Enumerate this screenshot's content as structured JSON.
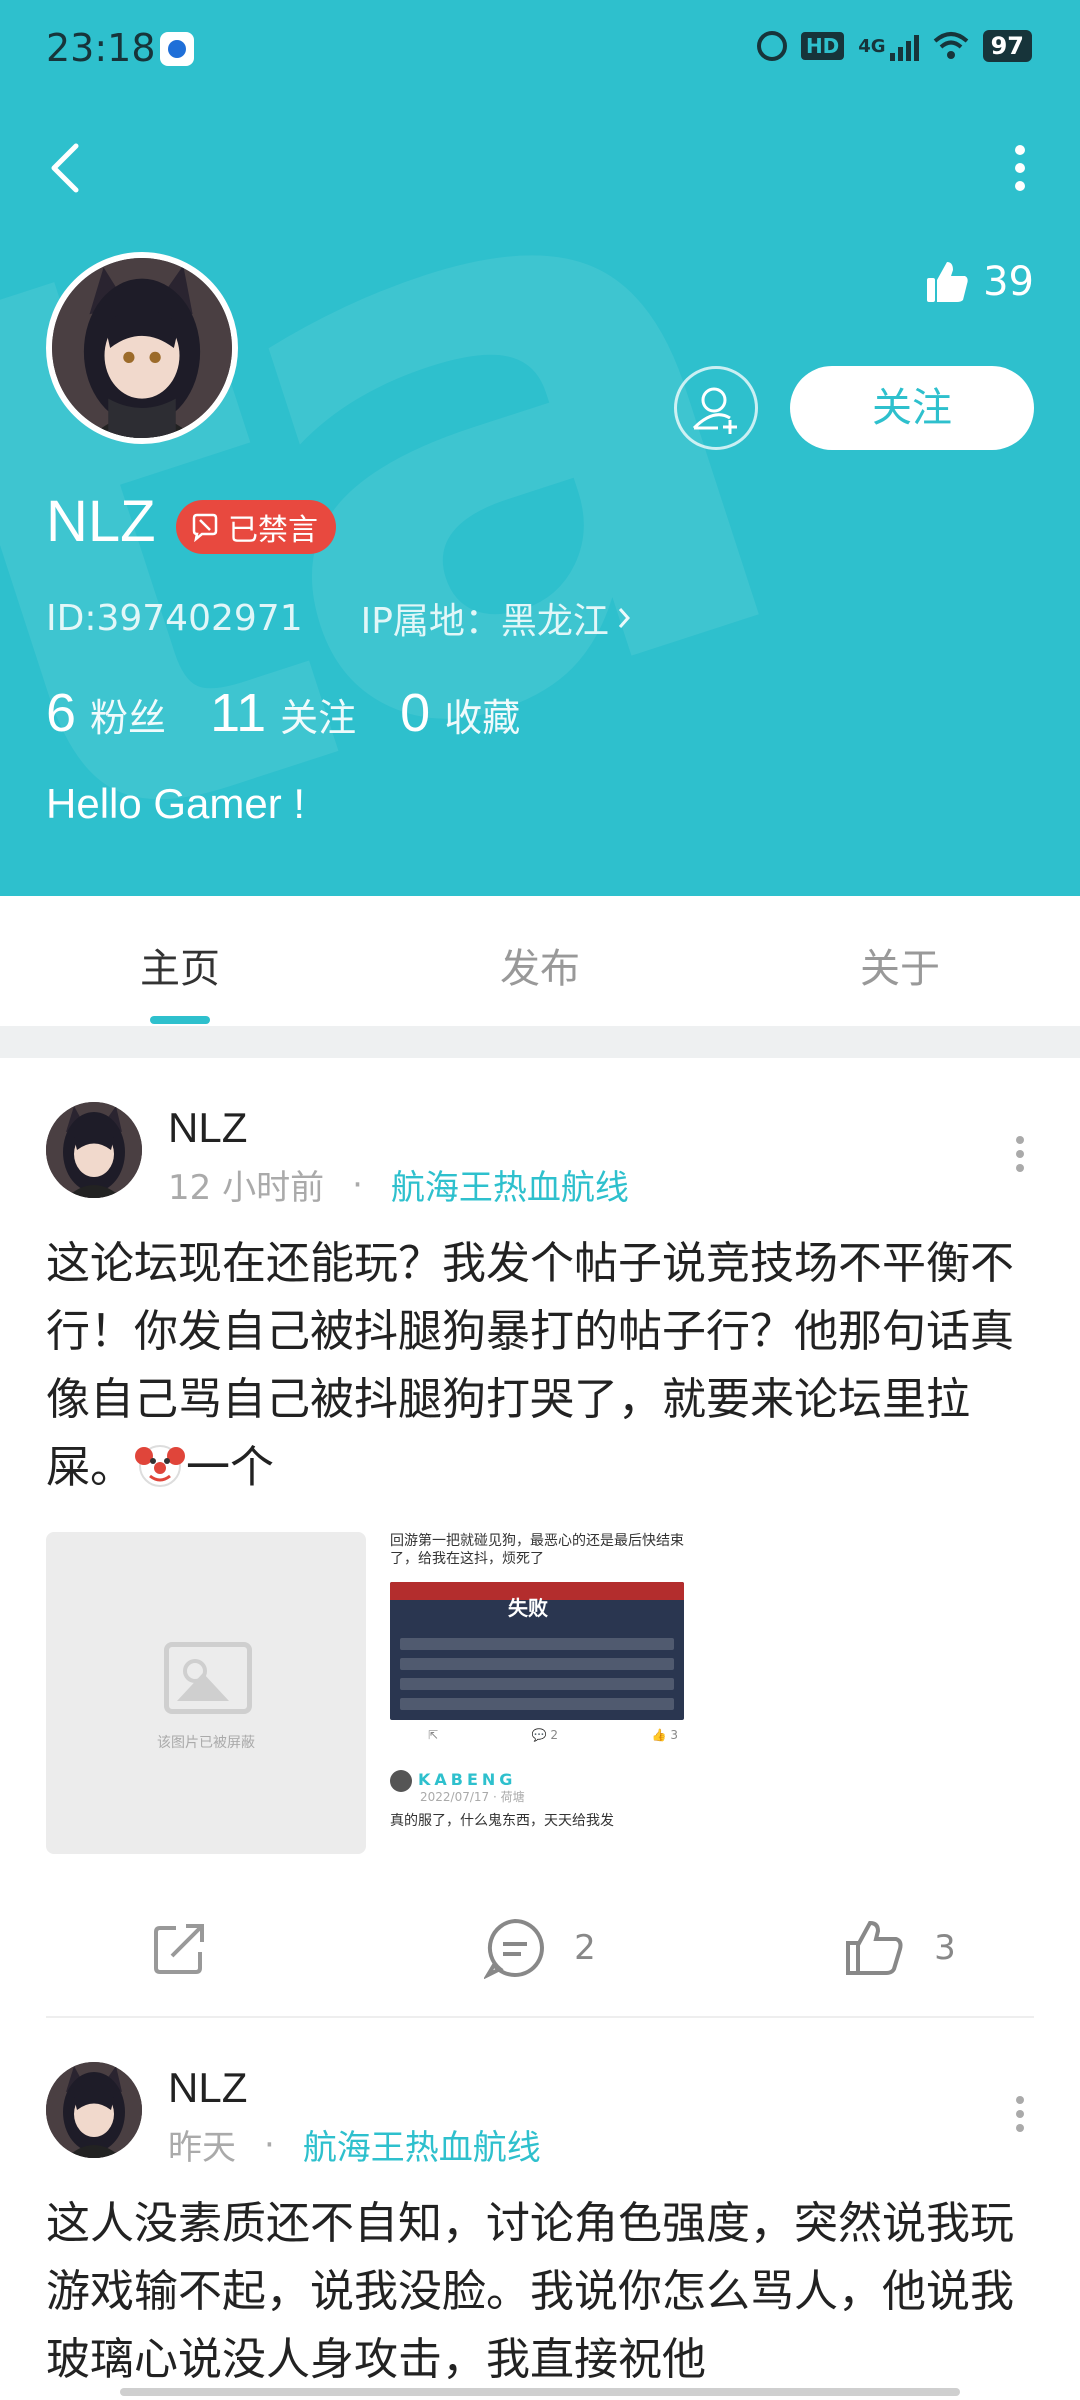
{
  "status_bar": {
    "time": "23:18",
    "network": "4G",
    "hd": "HD",
    "battery": "97"
  },
  "profile": {
    "likes": "39",
    "follow_label": "关注",
    "username": "NLZ",
    "banned_label": "已禁言",
    "id_text": "ID:397402971",
    "ip_text": "IP属地：黑龙江",
    "bio": "Hello Gamer !",
    "stats": [
      {
        "num": "6",
        "label": "粉丝"
      },
      {
        "num": "11",
        "label": "关注"
      },
      {
        "num": "0",
        "label": "收藏"
      }
    ]
  },
  "tabs": [
    {
      "label": "主页",
      "active": true
    },
    {
      "label": "发布",
      "active": false
    },
    {
      "label": "关于",
      "active": false
    }
  ],
  "posts": [
    {
      "author": "NLZ",
      "time": "12 小时前",
      "forum": "航海王热血航线",
      "text": "这论坛现在还能玩？我发个帖子说竞技场不平衡不行！你发自己被抖腿狗暴打的帖子行？他那句话真像自己骂自己被抖腿狗打哭了，就要来论坛里拉屎。",
      "text_tail": "一个",
      "blocked_image_text": "该图片已被屏蔽",
      "shot_caption": "回游第一把就碰见狗，最恶心的还是最后快结束了，给我在这抖，烦死了",
      "shot_center_text": "失败",
      "shot_comments": "2",
      "shot_likes": "3",
      "shot_user": "KABENG",
      "shot_date": "2022/07/17 · 荷塘",
      "shot_text": "真的服了，什么鬼东西，天天给我发",
      "comments": "2",
      "likes": "3"
    },
    {
      "author": "NLZ",
      "time": "昨天",
      "forum": "航海王热血航线",
      "text": "这人没素质还不自知，讨论角色强度，突然说我玩游戏输不起，说我没脸。我说你怎么骂人，他说我玻璃心说没人身攻击，我直接祝他"
    }
  ]
}
